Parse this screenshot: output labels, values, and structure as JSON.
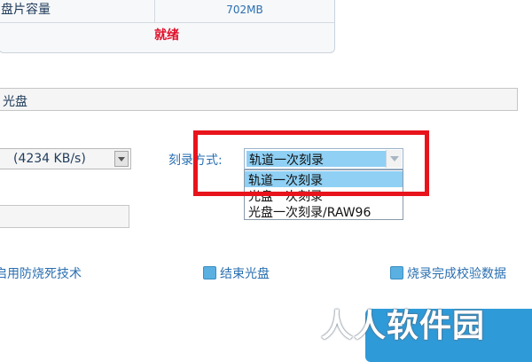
{
  "info": {
    "capacity_label": "盘片容量",
    "capacity_value": "702MB",
    "status": "就绪"
  },
  "disc_name": {
    "value": "光盘"
  },
  "speed": {
    "value": "(4234 KB/s)"
  },
  "burn_mode": {
    "label": "刻录方式:",
    "selected": "轨道一次刻录",
    "options": [
      "轨道一次刻录",
      "光盘一次刻录",
      "光盘一次刻录/RAW96"
    ]
  },
  "options": {
    "burnproof": "启用防烧死技术",
    "finalize": "结束光盘",
    "verify": "烧录完成校验数据"
  },
  "watermark": "人人软件园",
  "colors": {
    "highlight": "#e8141c",
    "status": "#e0102a",
    "selection": "#8fd0f4",
    "checkbox": "#5ab0e0",
    "button": "#2f9ad8"
  }
}
